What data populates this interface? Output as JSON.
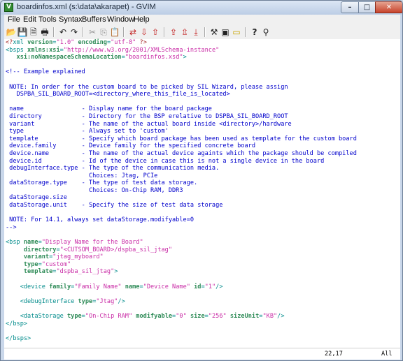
{
  "window": {
    "title": "boardinfos.xml (s:\\data\\akarapet) - GVIM"
  },
  "titlebar_buttons": {
    "minimize": "–",
    "maximize": "□",
    "close": "✕"
  },
  "menu": [
    "File",
    "Edit",
    "Tools",
    "Syntax",
    "Buffers",
    "Window",
    "Help"
  ],
  "toolbar": [
    {
      "name": "open-icon",
      "glyph": "📂"
    },
    {
      "name": "save-icon",
      "glyph": "💾"
    },
    {
      "name": "save-all-icon",
      "glyph": "🗎"
    },
    {
      "name": "print-icon",
      "glyph": "🖶"
    },
    {
      "name": "undo-icon",
      "glyph": "↶"
    },
    {
      "name": "redo-icon",
      "glyph": "↷"
    },
    {
      "name": "cut-icon",
      "glyph": "✂"
    },
    {
      "name": "copy-icon",
      "glyph": "⎘"
    },
    {
      "name": "paste-icon",
      "glyph": "📋"
    },
    {
      "name": "replace-icon",
      "glyph": "⇄"
    },
    {
      "name": "find-next-icon",
      "glyph": "⇩"
    },
    {
      "name": "find-prev-icon",
      "glyph": "⇧"
    },
    {
      "name": "load-session-icon",
      "glyph": "⇪"
    },
    {
      "name": "save-session-icon",
      "glyph": "⇫"
    },
    {
      "name": "run-script-icon",
      "glyph": "⤓"
    },
    {
      "name": "make-icon",
      "glyph": "⚒"
    },
    {
      "name": "shell-icon",
      "glyph": "▣"
    },
    {
      "name": "ctags-icon",
      "glyph": "▭"
    },
    {
      "name": "help-icon",
      "glyph": "?"
    },
    {
      "name": "find-help-icon",
      "glyph": "⚲"
    }
  ],
  "colors": {
    "comment": "#0000cc",
    "tag": "#008b8b",
    "attribute": "#2e8b57",
    "value": "#c92ca6",
    "header": "#a52a2a"
  },
  "code_lines": [
    [
      [
        "hdr",
        "<?"
      ],
      [
        "tag",
        "xml"
      ],
      [
        "attr",
        " version"
      ],
      [
        "tag",
        "="
      ],
      [
        "val",
        "\"1.0\""
      ],
      [
        "attr",
        " encoding"
      ],
      [
        "tag",
        "="
      ],
      [
        "val",
        "\"utf-8\""
      ],
      [
        "hdr",
        " ?>"
      ]
    ],
    [
      [
        "tag",
        "<bsps"
      ],
      [
        "attr",
        " xmlns:xsi"
      ],
      [
        "tag",
        "="
      ],
      [
        "val",
        "\"http://www.w3.org/2001/XMLSchema-instance\""
      ]
    ],
    [
      [
        "plain",
        "   "
      ],
      [
        "attr",
        "xsi:noNamespaceSchemaLocation"
      ],
      [
        "tag",
        "="
      ],
      [
        "val",
        "\"boardinfos.xsd\""
      ],
      [
        "tag",
        ">"
      ]
    ],
    [
      [
        "plain",
        ""
      ]
    ],
    [
      [
        "com",
        "<!-- Example explained"
      ]
    ],
    [
      [
        "plain",
        ""
      ]
    ],
    [
      [
        "com",
        " NOTE: In order for the custom board to be picked by SIL Wizard, please assign"
      ]
    ],
    [
      [
        "com",
        "   DSPBA_SIL_BOARD_ROOT=<directory_where_this_file_is_located>"
      ]
    ],
    [
      [
        "plain",
        ""
      ]
    ],
    [
      [
        "com",
        " name                - Display name for the board package"
      ]
    ],
    [
      [
        "com",
        " directory           - Directory for the BSP erelative to DSPBA_SIL_BOARD_ROOT"
      ]
    ],
    [
      [
        "com",
        " variant             - The name of the actual board inside <directory>/hardware"
      ]
    ],
    [
      [
        "com",
        " type                - Always set to 'custom'"
      ]
    ],
    [
      [
        "com",
        " template            - Specify which board package has been used as template for the custom board"
      ]
    ],
    [
      [
        "com",
        " device.family       - Device family for the specified concrete board"
      ]
    ],
    [
      [
        "com",
        " device.name         - The name of the actual device againts which the package should be compiled"
      ]
    ],
    [
      [
        "com",
        " device.id           - Id of the device in case this is not a single device in the board"
      ]
    ],
    [
      [
        "com",
        " debugInterface.type - The type of the communication media."
      ]
    ],
    [
      [
        "com",
        "                       Choices: Jtag, PCIe"
      ]
    ],
    [
      [
        "com",
        " dataStorage.type    - The type of test data storage."
      ]
    ],
    [
      [
        "com",
        "                       Choices: On-Chip RAM, DDR3"
      ]
    ],
    [
      [
        "com",
        " dataStorage.size"
      ]
    ],
    [
      [
        "com",
        " dataStorage.unit    - Specify the size of test data storage"
      ]
    ],
    [
      [
        "plain",
        ""
      ]
    ],
    [
      [
        "com",
        " NOTE: For 14.1, always set dataStorage.modifyable=0"
      ]
    ],
    [
      [
        "com",
        "-->"
      ]
    ],
    [
      [
        "plain",
        ""
      ]
    ],
    [
      [
        "tag",
        "<bsp"
      ],
      [
        "attr",
        " name"
      ],
      [
        "tag",
        "="
      ],
      [
        "val",
        "\"Display Name for the Board\""
      ]
    ],
    [
      [
        "plain",
        "     "
      ],
      [
        "attr",
        "directory"
      ],
      [
        "tag",
        "="
      ],
      [
        "val",
        "\"<CUTSOM_BOARD>/dspba_sil_jtag\""
      ]
    ],
    [
      [
        "plain",
        "     "
      ],
      [
        "attr",
        "variant"
      ],
      [
        "tag",
        "="
      ],
      [
        "val",
        "\"jtag_myboard\""
      ]
    ],
    [
      [
        "plain",
        "     "
      ],
      [
        "attr",
        "type"
      ],
      [
        "tag",
        "="
      ],
      [
        "val",
        "\"custom\""
      ]
    ],
    [
      [
        "plain",
        "     "
      ],
      [
        "attr",
        "template"
      ],
      [
        "tag",
        "="
      ],
      [
        "val",
        "\"dspba_sil_jtag\""
      ],
      [
        "tag",
        ">"
      ]
    ],
    [
      [
        "plain",
        ""
      ]
    ],
    [
      [
        "plain",
        "    "
      ],
      [
        "tag",
        "<device"
      ],
      [
        "attr",
        " family"
      ],
      [
        "tag",
        "="
      ],
      [
        "val",
        "\"Family Name\""
      ],
      [
        "attr",
        " name"
      ],
      [
        "tag",
        "="
      ],
      [
        "val",
        "\"Device Name\""
      ],
      [
        "attr",
        " id"
      ],
      [
        "tag",
        "="
      ],
      [
        "val",
        "\"1\""
      ],
      [
        "tag",
        "/>"
      ]
    ],
    [
      [
        "plain",
        ""
      ]
    ],
    [
      [
        "plain",
        "    "
      ],
      [
        "tag",
        "<debugInterface"
      ],
      [
        "attr",
        " type"
      ],
      [
        "tag",
        "="
      ],
      [
        "val",
        "\"Jtag\""
      ],
      [
        "tag",
        "/>"
      ]
    ],
    [
      [
        "plain",
        ""
      ]
    ],
    [
      [
        "plain",
        "    "
      ],
      [
        "tag",
        "<dataStorage"
      ],
      [
        "attr",
        " type"
      ],
      [
        "tag",
        "="
      ],
      [
        "val",
        "\"On-Chip RAM\""
      ],
      [
        "attr",
        " modifyable"
      ],
      [
        "tag",
        "="
      ],
      [
        "val",
        "\"0\""
      ],
      [
        "attr",
        " size"
      ],
      [
        "tag",
        "="
      ],
      [
        "val",
        "\"256\""
      ],
      [
        "attr",
        " sizeUnit"
      ],
      [
        "tag",
        "="
      ],
      [
        "val",
        "\"KB\""
      ],
      [
        "tag",
        "/>"
      ]
    ],
    [
      [
        "tag",
        "</bsp>"
      ]
    ],
    [
      [
        "plain",
        ""
      ]
    ],
    [
      [
        "tag",
        "</bsps>"
      ]
    ]
  ],
  "status": {
    "position": "22,17",
    "scroll": "All"
  }
}
